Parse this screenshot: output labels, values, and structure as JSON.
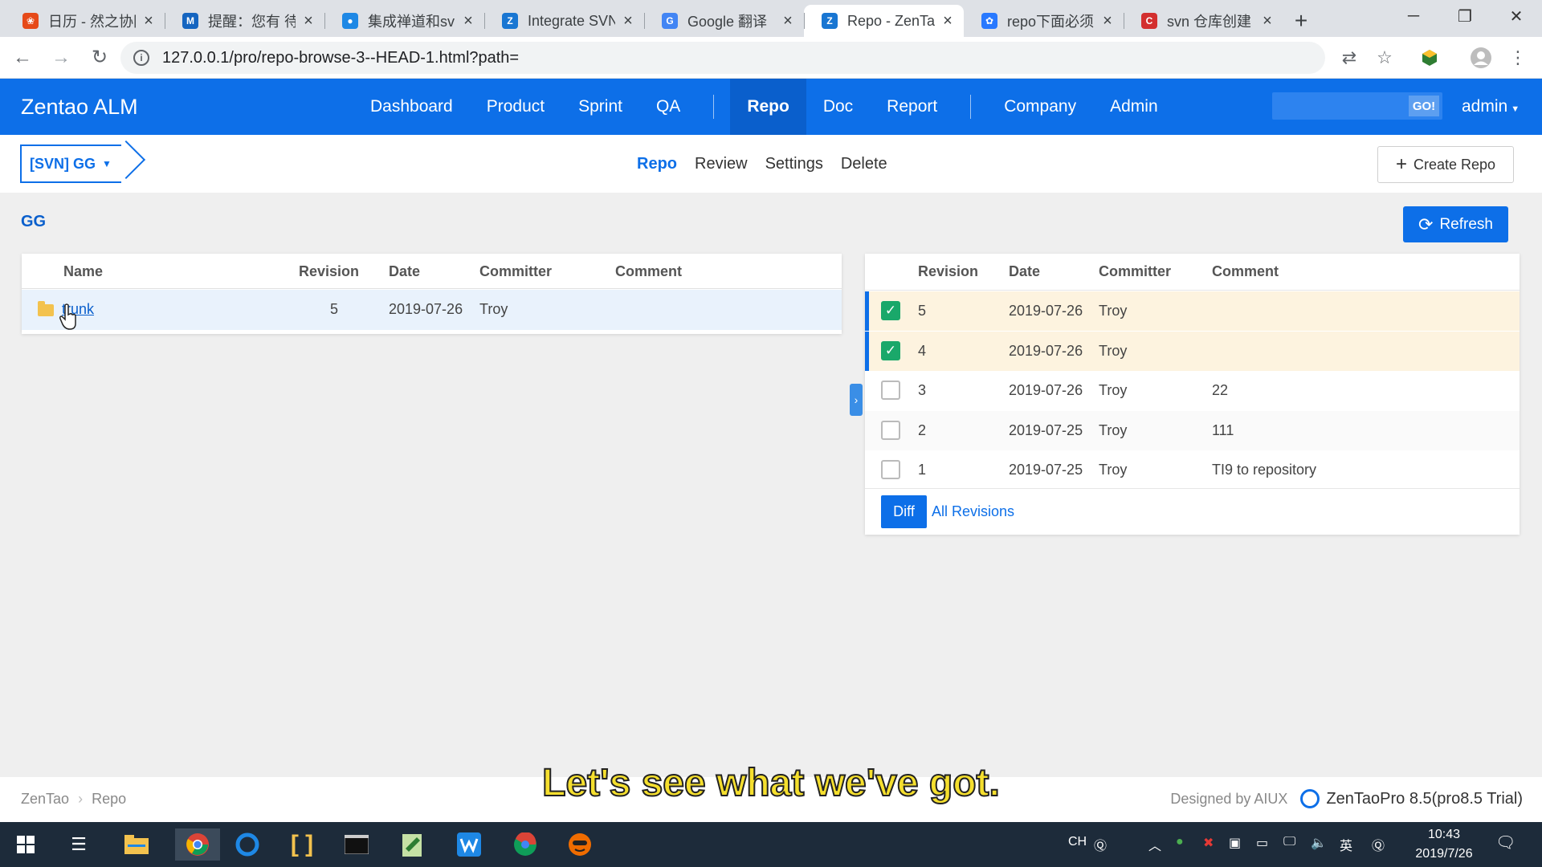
{
  "browser": {
    "tabs": [
      {
        "title": "日历 - 然之协同",
        "fav_color": "#e64a19",
        "fav_glyph": "❀",
        "icon": "calendar-app-icon"
      },
      {
        "title": "提醒：您有 待",
        "fav_color": "#1565c0",
        "fav_glyph": "M",
        "icon": "mail-icon"
      },
      {
        "title": "集成禅道和svn",
        "fav_color": "#1e88e5",
        "fav_glyph": "●",
        "icon": "web-icon"
      },
      {
        "title": "Integrate SVN",
        "fav_color": "#1976d2",
        "fav_glyph": "Z",
        "icon": "zentao-icon"
      },
      {
        "title": "Google 翻译",
        "fav_color": "#4285f4",
        "fav_glyph": "G",
        "icon": "translate-icon"
      },
      {
        "title": "Repo - ZenTao",
        "fav_color": "#1976d2",
        "fav_glyph": "Z",
        "icon": "zentao-icon",
        "active": true
      },
      {
        "title": "repo下面必须",
        "fav_color": "#2979ff",
        "fav_glyph": "✿",
        "icon": "baidu-icon"
      },
      {
        "title": "svn 仓库创建",
        "fav_color": "#d32f2f",
        "fav_glyph": "C",
        "icon": "csdn-icon"
      }
    ],
    "url": "127.0.0.1/pro/repo-browse-3--HEAD-1.html?path="
  },
  "app": {
    "brand": "Zentao ALM",
    "nav": {
      "dashboard": "Dashboard",
      "product": "Product",
      "sprint": "Sprint",
      "qa": "QA",
      "repo": "Repo",
      "doc": "Doc",
      "report": "Report",
      "company": "Company",
      "admin": "Admin"
    },
    "search_go": "GO!",
    "user": "admin",
    "accent": "#0d6fe8"
  },
  "subnav": {
    "repo_picker": "[SVN] GG",
    "items": {
      "repo": "Repo",
      "review": "Review",
      "settings": "Settings",
      "delete": "Delete"
    },
    "create_repo": "Create Repo"
  },
  "content": {
    "repo_name": "GG",
    "refresh": "Refresh",
    "files": {
      "columns": {
        "name": "Name",
        "revision": "Revision",
        "date": "Date",
        "committer": "Committer",
        "comment": "Comment"
      },
      "rows": [
        {
          "name": "trunk",
          "revision": "5",
          "date": "2019-07-26",
          "committer": "Troy",
          "comment": ""
        }
      ]
    },
    "revisions": {
      "columns": {
        "revision": "Revision",
        "date": "Date",
        "committer": "Committer",
        "comment": "Comment"
      },
      "rows": [
        {
          "revision": "5",
          "date": "2019-07-26",
          "committer": "Troy",
          "comment": "",
          "checked": true
        },
        {
          "revision": "4",
          "date": "2019-07-26",
          "committer": "Troy",
          "comment": "",
          "checked": true
        },
        {
          "revision": "3",
          "date": "2019-07-26",
          "committer": "Troy",
          "comment": "22",
          "checked": false
        },
        {
          "revision": "2",
          "date": "2019-07-25",
          "committer": "Troy",
          "comment": "111",
          "checked": false
        },
        {
          "revision": "1",
          "date": "2019-07-25",
          "committer": "Troy",
          "comment": "TI9 to repository",
          "checked": false
        }
      ],
      "diff": "Diff",
      "all_revisions": "All Revisions"
    }
  },
  "footer": {
    "crumb_root": "ZenTao",
    "crumb_sep": "›",
    "crumb_current": "Repo",
    "designed_by": "Designed by AIUX",
    "edition": "ZenTaoPro 8.5(pro8.5 Trial)"
  },
  "subtitle": "Let's see what we've got.",
  "taskbar": {
    "tray_ime1": "CH",
    "tray_ime2": "英",
    "time": "10:43",
    "date": "2019/7/26"
  }
}
